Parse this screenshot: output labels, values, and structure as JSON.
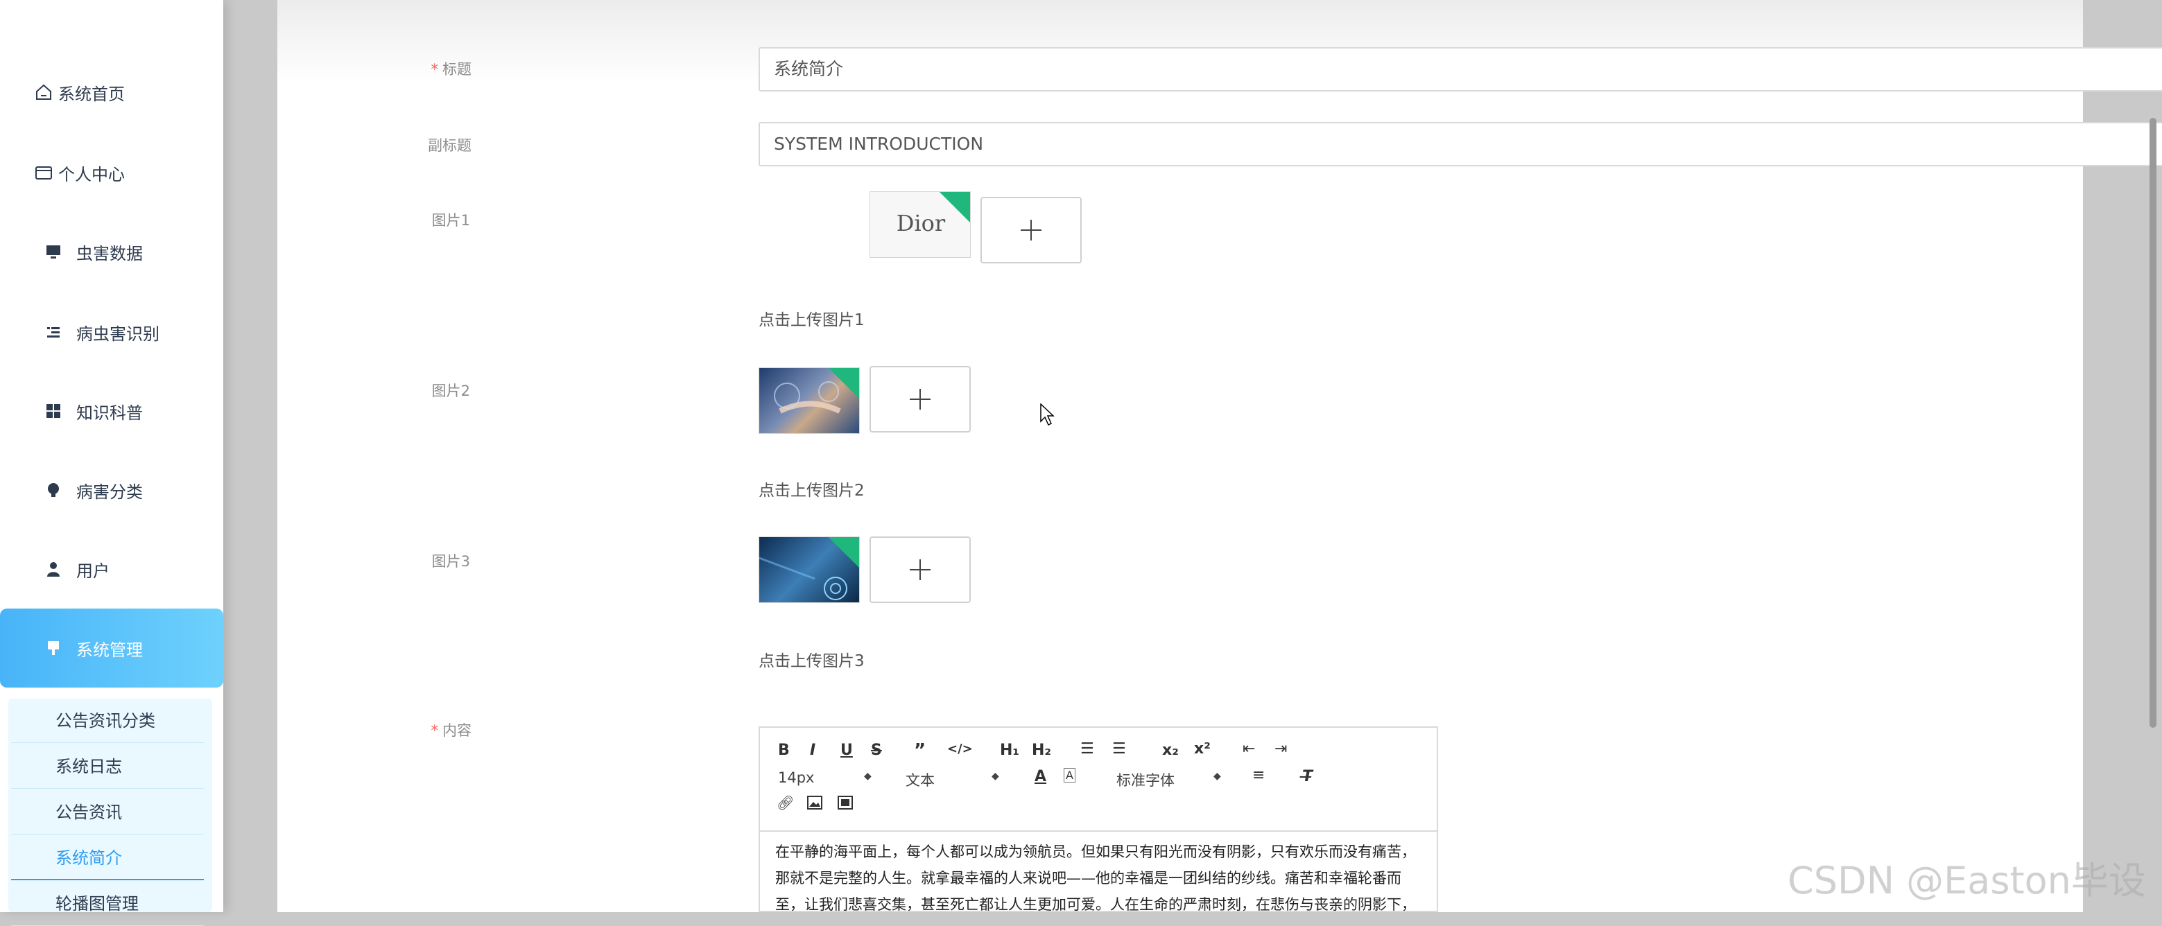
{
  "sidebar": {
    "items": [
      {
        "label": "系统首页",
        "icon": "home-icon"
      },
      {
        "label": "个人中心",
        "icon": "wallet-icon"
      },
      {
        "label": "虫害数据",
        "icon": "monitor-icon"
      },
      {
        "label": "病虫害识别",
        "icon": "list-icon"
      },
      {
        "label": "知识科普",
        "icon": "grid-icon"
      },
      {
        "label": "病害分类",
        "icon": "bulb-icon"
      },
      {
        "label": "用户",
        "icon": "user-icon"
      },
      {
        "label": "系统管理",
        "icon": "brush-icon"
      }
    ],
    "submenu": [
      {
        "label": "公告资讯分类"
      },
      {
        "label": "系统日志"
      },
      {
        "label": "公告资讯"
      },
      {
        "label": "系统简介"
      },
      {
        "label": "轮播图管理"
      }
    ],
    "active_item": "系统管理",
    "current_subitem": "系统简介"
  },
  "form": {
    "title_label": "标题",
    "title_value": "系统简介",
    "subtitle_label": "副标题",
    "subtitle_value": "SYSTEM INTRODUCTION",
    "image1_label": "图片1",
    "image1_thumb_text": "Dior",
    "image1_hint": "点击上传图片1",
    "image2_label": "图片2",
    "image2_hint": "点击上传图片2",
    "image3_label": "图片3",
    "image3_hint": "点击上传图片3",
    "content_label": "内容",
    "required_mark": "*"
  },
  "editor": {
    "font_size": "14px",
    "text_style": "文本",
    "font_family": "标准字体",
    "content_text": "在平静的海平面上，每个人都可以成为领航员。但如果只有阳光而没有阴影，只有欢乐而没有痛苦，那就不是完整的人生。就拿最幸福的人来说吧——他的幸福是一团纠结的纱线。痛苦和幸福轮番而至，让我们悲喜交集，甚至死亡都让人生更加可爱。人在生命的严肃时刻，在悲伤与丧亲的阴影下，才最接近真实的自我。在生活和事业的各个方面，才智的功能远不如性格，头脑的功能远不"
  },
  "watermark": "CSDN @Easton毕设",
  "colors": {
    "accent": "#48b4f8",
    "required": "#f2665c",
    "corner_badge": "#1fb77b"
  }
}
